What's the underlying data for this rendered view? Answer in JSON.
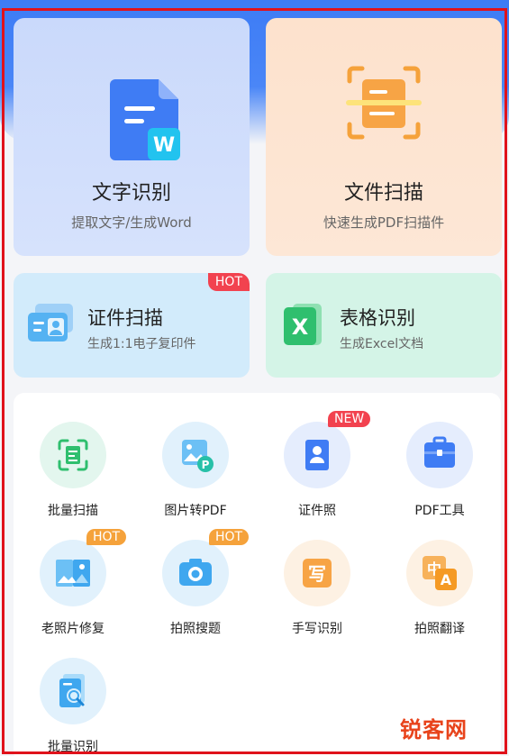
{
  "cards": {
    "ocr": {
      "title": "文字识别",
      "sub": "提取文字/生成Word"
    },
    "scan": {
      "title": "文件扫描",
      "sub": "快速生成PDF扫描件"
    },
    "id": {
      "title": "证件扫描",
      "sub": "生成1:1电子复印件",
      "badge": "HOT"
    },
    "table": {
      "title": "表格识别",
      "sub": "生成Excel文档"
    }
  },
  "tools": [
    {
      "label": "批量扫描"
    },
    {
      "label": "图片转PDF"
    },
    {
      "label": "证件照",
      "badge": "NEW"
    },
    {
      "label": "PDF工具"
    },
    {
      "label": "老照片修复",
      "badge": "HOT"
    },
    {
      "label": "拍照搜题",
      "badge": "HOT"
    },
    {
      "label": "手写识别"
    },
    {
      "label": "拍照翻译"
    },
    {
      "label": "批量识别"
    }
  ],
  "icons": {
    "word_letter": "W",
    "excel_letter": "X",
    "pdf_letter": "P",
    "handwrite_char": "写",
    "translate_zh": "中",
    "translate_en": "A"
  },
  "watermark": "锐客网",
  "colors": {
    "accent_blue": "#3d7cf5",
    "hot_red": "#f2424f",
    "hot_orange": "#f5a23b",
    "frame_red": "#e0121b"
  }
}
